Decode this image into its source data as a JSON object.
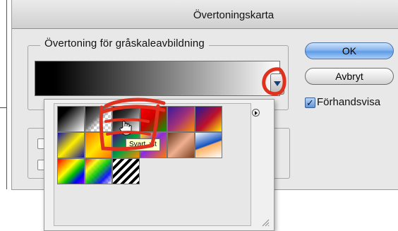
{
  "dialog": {
    "title": "Övertoningskarta",
    "group_label": "Övertoning för gråskaleavbildning",
    "ok_label": "OK",
    "cancel_label": "Avbryt",
    "preview_label": "Förhandsvisa",
    "preview_checked": true
  },
  "picker": {
    "tooltip": "Svart, vit",
    "swatches": [
      {
        "name": "black-white",
        "bg": "linear-gradient(135deg,#000 0%,#000 25%,#fff 100%)"
      },
      {
        "name": "transparent",
        "bg": "linear-gradient(135deg,#000 0%,#666 40%,rgba(255,255,255,0) 60%),repeating-conic-gradient(#cfcfcf 0% 25%,#fff 0% 50%) 0 0/8px 8px"
      },
      {
        "name": "black-white-2",
        "bg": "linear-gradient(135deg,#000 0%,#333 40%,#fff 100%)"
      },
      {
        "name": "red-green",
        "bg": "linear-gradient(135deg,#ff0000 0%,#c00 45%,#00a000 100%)"
      },
      {
        "name": "violet-orange",
        "bg": "linear-gradient(135deg,#3a1a9a 0%,#a0307a 50%,#ff8a00 100%)"
      },
      {
        "name": "blue-red-yellow",
        "bg": "linear-gradient(135deg,#1a1aa0 0%,#c0102a 55%,#ffee00 100%)"
      },
      {
        "name": "blue-yellow-blue",
        "bg": "linear-gradient(135deg,#1010a0 0%,#ffee00 50%,#1010a0 100%)"
      },
      {
        "name": "orange-yellow-orange",
        "bg": "linear-gradient(135deg,#ff7000 0%,#ffe600 50%,#ff7000 100%)"
      },
      {
        "name": "violet-green-orange",
        "bg": "linear-gradient(135deg,#4b0082 0%,#00a040 50%,#ff8c00 100%)"
      },
      {
        "name": "yellow-violet-orange",
        "bg": "linear-gradient(135deg,#ffe600 0%,#8a2be2 45%,#ff7a00 100%)"
      },
      {
        "name": "copper",
        "bg": "linear-gradient(135deg,#6a3a20 0%,#f0b090 50%,#7a4020 100%)"
      },
      {
        "name": "chrome",
        "bg": "linear-gradient(160deg,#ffffff 0%,#1050c0 48%,#ffb060 52%,#ffffff 100%)"
      },
      {
        "name": "spectrum",
        "bg": "linear-gradient(135deg,#ff0000,#ff8000,#ffff00,#00c000,#0000ff,#8000ff)"
      },
      {
        "name": "transparent-rainbow",
        "bg": "linear-gradient(135deg,rgba(255,0,0,0.9),rgba(255,255,0,0.9),rgba(0,200,0,0.9),rgba(0,0,255,0.9),rgba(255,255,255,0)),repeating-conic-gradient(#cfcfcf 0% 25%,#fff 0% 50%) 0 0/8px 8px"
      },
      {
        "name": "transparent-stripes",
        "bg": "repeating-linear-gradient(135deg,#000 0 4px,#fff 4px 8px)"
      }
    ]
  }
}
